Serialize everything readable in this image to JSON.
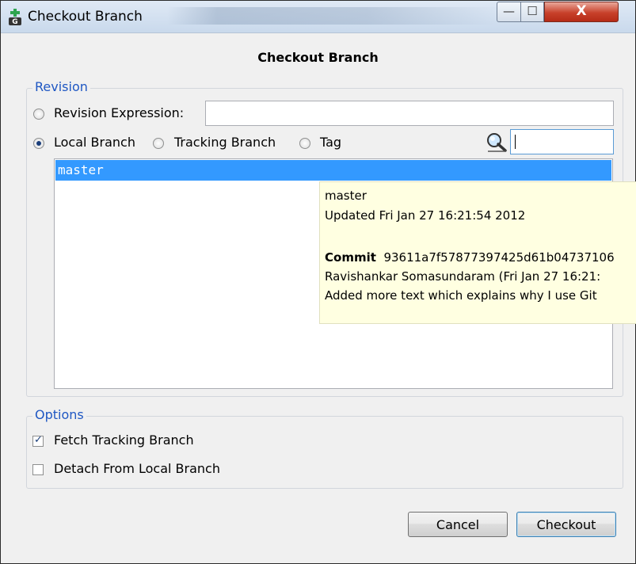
{
  "window": {
    "title": "Checkout Branch",
    "controls": {
      "minimize": "—",
      "maximize": "☐",
      "close": "X"
    }
  },
  "dialog": {
    "title": "Checkout Branch",
    "revision_group": {
      "legend": "Revision",
      "revision_expression_label": "Revision Expression:",
      "revision_expression_value": "",
      "local_branch_label": "Local Branch",
      "tracking_branch_label": "Tracking Branch",
      "tag_label": "Tag",
      "selected_option": "Local Branch",
      "search_icon": "magnifier-icon",
      "search_value": ""
    },
    "branches": [
      "master"
    ],
    "tooltip": {
      "name": "master",
      "updated": "Updated Fri Jan 27 16:21:54 2012",
      "commit_label": "Commit",
      "commit_hash": "93611a7f57877397425d61b04737106",
      "author": "Ravishankar Somasundaram (Fri Jan 27 16:21:",
      "message": "Added more text which explains why I use Git"
    },
    "options_group": {
      "legend": "Options",
      "fetch_tracking_label": "Fetch Tracking Branch",
      "fetch_tracking_checked": true,
      "detach_label": "Detach From Local Branch",
      "detach_checked": false
    },
    "buttons": {
      "cancel": "Cancel",
      "checkout": "Checkout"
    }
  }
}
